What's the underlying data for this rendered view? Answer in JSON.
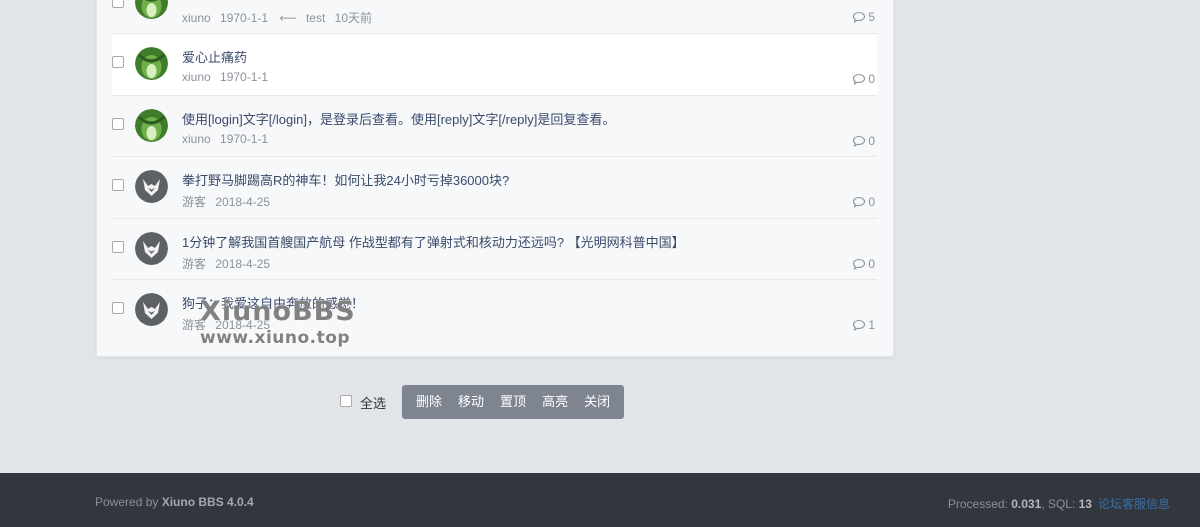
{
  "threads": [
    {
      "title": "",
      "author": "xiuno",
      "date": "1970-1-1",
      "last_reply_user": "test",
      "last_reply_time": "10天前",
      "replies": "5",
      "avatar": "green"
    },
    {
      "title": "爱心止痛药",
      "author": "xiuno",
      "date": "1970-1-1",
      "replies": "0",
      "avatar": "green"
    },
    {
      "title": "使用[login]文字[/login]，是登录后查看。使用[reply]文字[/reply]是回复查看。",
      "author": "xiuno",
      "date": "1970-1-1",
      "replies": "0",
      "avatar": "green"
    },
    {
      "title": "拳打野马脚踢高R的神车！如何让我24小时亏掉36000块?",
      "author": "游客",
      "date": "2018-4-25",
      "replies": "0",
      "avatar": "guest"
    },
    {
      "title": "1分钟了解我国首艘国产航母 作战型都有了弹射式和核动力还远吗? 【光明网科普中国】",
      "author": "游客",
      "date": "2018-4-25",
      "replies": "0",
      "avatar": "guest"
    },
    {
      "title": "狗子：我爱这自由奔放的感觉！",
      "author": "游客",
      "date": "2018-4-25",
      "replies": "1",
      "avatar": "guest"
    }
  ],
  "watermark": {
    "line1": "XiunoBBS",
    "line2": "www.xiuno.top"
  },
  "moderation": {
    "select_all": "全选",
    "buttons": [
      "删除",
      "移动",
      "置顶",
      "高亮",
      "关闭"
    ]
  },
  "footer": {
    "powered_prefix": "Powered by ",
    "powered_name": "Xiuno BBS 4.0.4",
    "processed_label": "Processed: ",
    "processed_value": "0.031",
    "sql_label": ", SQL: ",
    "sql_value": "13",
    "link_text": "论坛客服信息"
  },
  "colors": {
    "page_bg": "#e1e4e8",
    "card_bg": "#f7f8fa",
    "title_color": "#3a4a6b",
    "meta_color": "#8b9299",
    "button_group_bg": "#7e8590",
    "footer_bg": "#33373d",
    "footer_link": "#3a6ea5"
  }
}
